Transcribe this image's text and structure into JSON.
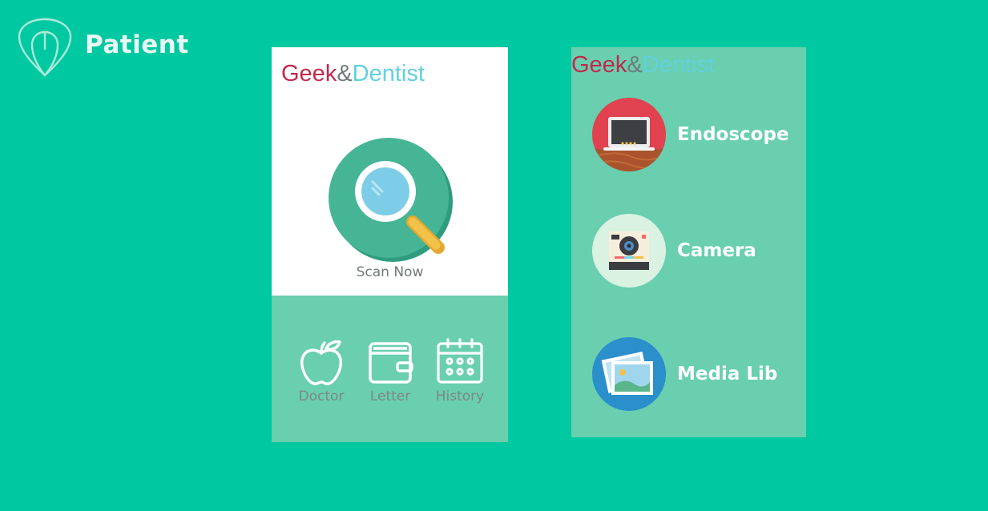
{
  "brand": {
    "title": "Patient"
  },
  "left_screen": {
    "logo": {
      "geek": "Geek",
      "amp": "&",
      "dentist": "Dentist"
    },
    "scan": {
      "label": "Scan Now",
      "icon": "magnifier-icon"
    },
    "nav": [
      {
        "label": "Doctor",
        "icon": "apple-icon"
      },
      {
        "label": "Letter",
        "icon": "wallet-icon"
      },
      {
        "label": "History",
        "icon": "calendar-icon"
      }
    ]
  },
  "right_screen": {
    "logo": {
      "geek": "Geek",
      "amp": "&",
      "dentist": "Dentist"
    },
    "menu": [
      {
        "label": "Endoscope",
        "icon": "monitor-icon",
        "color": "#E0434F"
      },
      {
        "label": "Camera",
        "icon": "camera-icon",
        "color": "#D9F2E2"
      },
      {
        "label": "Media Lib",
        "icon": "photos-icon",
        "color": "#2A8FCB"
      }
    ]
  },
  "colors": {
    "background": "#00C8A0",
    "panel": "#69CFAF",
    "logo_geek": "#C0294D",
    "logo_dentist": "#62D0DE"
  }
}
